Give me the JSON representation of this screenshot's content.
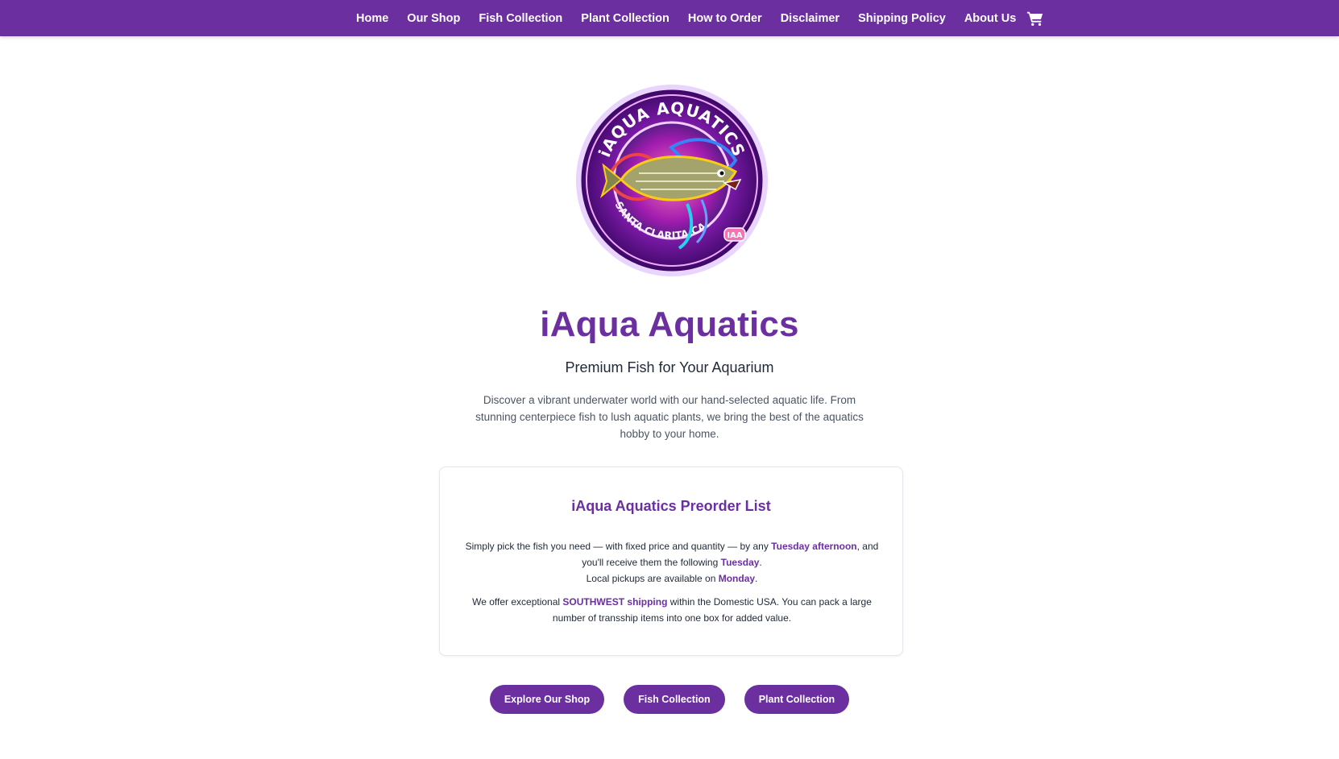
{
  "nav": {
    "items": [
      {
        "label": "Home"
      },
      {
        "label": "Our Shop"
      },
      {
        "label": "Fish Collection"
      },
      {
        "label": "Plant Collection"
      },
      {
        "label": "How to Order"
      },
      {
        "label": "Disclaimer"
      },
      {
        "label": "Shipping Policy"
      },
      {
        "label": "About Us"
      }
    ],
    "cart_icon": "shopping-cart-icon"
  },
  "logo": {
    "ring_text": "iAQUA AQUATICS",
    "location_text": "SANTA CLARITA,CA.",
    "badge_text": "IAA"
  },
  "hero": {
    "title": "iAqua Aquatics",
    "tagline": "Premium Fish for Your Aquarium",
    "intro": "Discover a vibrant underwater world with our hand-selected aquatic life. From stunning centerpiece fish to lush aquatic plants, we bring the best of the aquatics hobby to your home."
  },
  "preorder": {
    "title": "iAqua Aquatics Preorder List",
    "line1_pre": "Simply pick the fish you need — with fixed price and quantity — by any ",
    "line1_bold": "Tuesday afternoon",
    "line1_mid": ", and you'll receive them the following ",
    "line1_bold2": "Tuesday",
    "line1_end": ".",
    "line2_pre": "Local pickups are available on ",
    "line2_bold": "Monday",
    "line2_end": ".",
    "line3_pre": "We offer exceptional ",
    "line3_bold": "SOUTHWEST shipping",
    "line3_end": " within the Domestic USA. You can pack a large number of transship items into one box for added value."
  },
  "buttons": {
    "explore": "Explore Our Shop",
    "fish": "Fish Collection",
    "plant": "Plant Collection"
  },
  "colors": {
    "brand": "#6b2fa0",
    "text": "#374151"
  }
}
